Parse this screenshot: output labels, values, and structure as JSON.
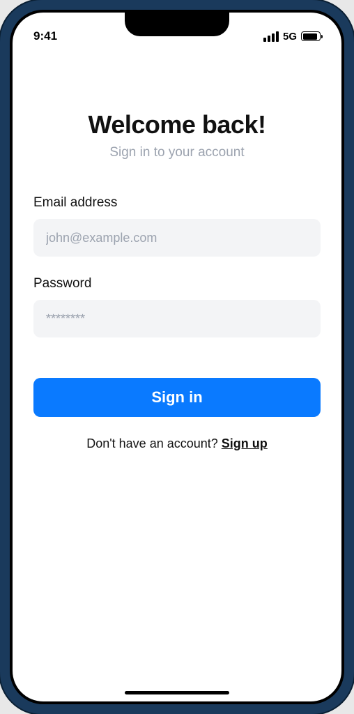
{
  "status": {
    "time": "9:41",
    "network": "5G"
  },
  "header": {
    "title": "Welcome back!",
    "subtitle": "Sign in to your account"
  },
  "form": {
    "email_label": "Email address",
    "email_placeholder": "john@example.com",
    "password_label": "Password",
    "password_placeholder": "********"
  },
  "actions": {
    "signin_label": "Sign in",
    "signup_prompt": "Don't have an account? ",
    "signup_link": "Sign up"
  }
}
